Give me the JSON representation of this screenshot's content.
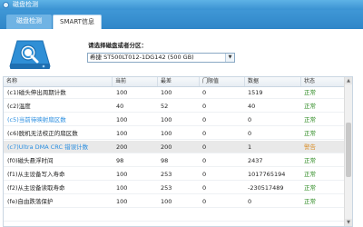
{
  "window": {
    "title": "磁盘检测"
  },
  "tabs": [
    {
      "label": "磁盘检测",
      "active": false
    },
    {
      "label": "SMART信息",
      "active": true
    }
  ],
  "disk_select": {
    "label": "请选择磁盘或者分区：",
    "value": "希捷 ST500LT012-1DG142  (500 GB)"
  },
  "table": {
    "headers": [
      "名称",
      "当前",
      "最差",
      "门限值",
      "数据",
      "状态"
    ],
    "rows": [
      {
        "name": "(c1)磁头伸出周期计数",
        "current": "100",
        "worst": "100",
        "threshold": "0",
        "data": "1519",
        "status": "正常",
        "level": "ok"
      },
      {
        "name": "(c2)温度",
        "current": "40",
        "worst": "52",
        "threshold": "0",
        "data": "40",
        "status": "正常",
        "level": "ok"
      },
      {
        "name": "(c5)当前待映射扇区数",
        "current": "100",
        "worst": "100",
        "threshold": "0",
        "data": "0",
        "status": "正常",
        "level": "ok",
        "highlight": true
      },
      {
        "name": "(c6)脱机无法校正的扇区数",
        "current": "100",
        "worst": "100",
        "threshold": "0",
        "data": "0",
        "status": "正常",
        "level": "ok"
      },
      {
        "name": "(c7)Ultra DMA CRC 错误计数",
        "current": "200",
        "worst": "200",
        "threshold": "0",
        "data": "1",
        "status": "警告",
        "level": "warn",
        "highlight": true,
        "selected": true
      },
      {
        "name": "(f0)磁头悬浮时间",
        "current": "98",
        "worst": "98",
        "threshold": "0",
        "data": "2437",
        "status": "正常",
        "level": "ok"
      },
      {
        "name": "(f1)从主设备写入寿命",
        "current": "100",
        "worst": "253",
        "threshold": "0",
        "data": "1017765194",
        "status": "正常",
        "level": "ok"
      },
      {
        "name": "(f2)从主设备读取寿命",
        "current": "100",
        "worst": "253",
        "threshold": "0",
        "data": "-230517489",
        "status": "正常",
        "level": "ok"
      },
      {
        "name": "(fe)自由跌落保护",
        "current": "100",
        "worst": "100",
        "threshold": "0",
        "data": "0",
        "status": "正常",
        "level": "ok"
      },
      {
        "name": "",
        "current": "",
        "worst": "",
        "threshold": "",
        "data": "",
        "status": "",
        "level": ""
      }
    ]
  },
  "colors": {
    "accent": "#3a92d2",
    "ok": "#2e8b23",
    "warn": "#d9902c",
    "highlight_text": "#2a8ee0"
  },
  "icons": {
    "app": "disk-app-icon",
    "disk": "disk-magnifier-icon"
  }
}
